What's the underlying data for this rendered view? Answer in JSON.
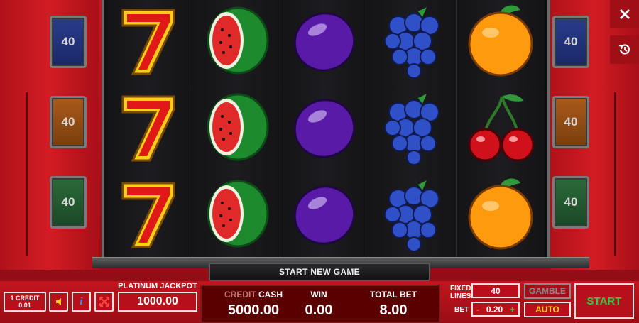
{
  "line_badges": {
    "left": [
      "40",
      "40",
      "40"
    ],
    "right": [
      "40",
      "40",
      "40"
    ]
  },
  "reels": {
    "columns": [
      [
        "seven",
        "seven",
        "seven"
      ],
      [
        "watermelon",
        "watermelon",
        "watermelon"
      ],
      [
        "plum",
        "plum",
        "plum"
      ],
      [
        "grapes",
        "grapes",
        "grapes"
      ],
      [
        "orange",
        "cherries",
        "orange"
      ]
    ]
  },
  "start_new_game": "START NEW GAME",
  "controls": {
    "credit_line1": "1 CREDIT",
    "credit_line2": "0.01",
    "sound_icon": "speaker-icon",
    "info_icon": "info-icon",
    "fullscreen_icon": "expand-arrows-icon",
    "jackpot_label": "PLATINUM JACKPOT",
    "jackpot_value": "1000.00",
    "credit_label": "CREDIT",
    "cash_label": "CASH",
    "cash_value": "5000.00",
    "win_label": "WIN",
    "win_value": "0.00",
    "total_bet_label": "TOTAL BET",
    "total_bet_value": "8.00",
    "fixed_lines_label_1": "FIXED",
    "fixed_lines_label_2": "LINES",
    "lines_value": "40",
    "bet_label": "BET",
    "bet_value": "0.20",
    "bet_minus": "-",
    "bet_plus": "+",
    "gamble_label": "GAMBLE",
    "auto_label": "AUTO",
    "start_label": "START"
  },
  "corner": {
    "close_icon": "close-icon",
    "history_icon": "history-icon"
  },
  "colors": {
    "cabinet_red": "#c8141c",
    "start_green": "#32c84a",
    "auto_yellow": "#ffd21a"
  }
}
